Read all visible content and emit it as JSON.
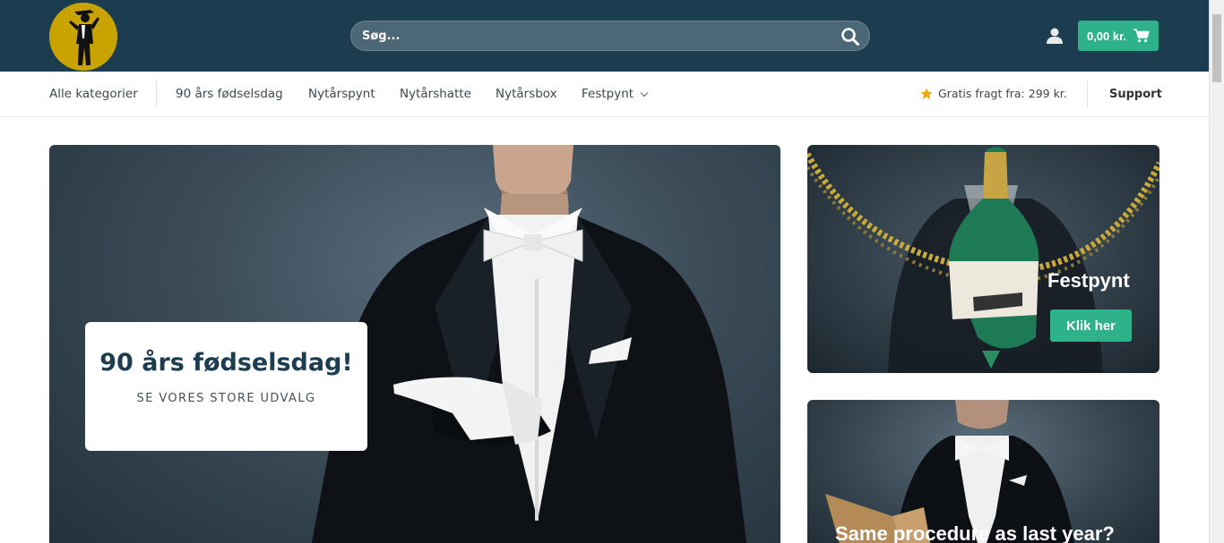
{
  "header": {
    "logo_alt": "Festlogo",
    "search": {
      "placeholder": "Søg..."
    },
    "cart": {
      "total": "0,00 kr."
    }
  },
  "nav": {
    "all_categories": "Alle kategorier",
    "items": [
      {
        "label": "90 års fødselsdag"
      },
      {
        "label": "Nytårspynt"
      },
      {
        "label": "Nytårshatte"
      },
      {
        "label": "Nytårsbox"
      },
      {
        "label": "Festpynt"
      }
    ],
    "shipping_text": "Gratis fragt fra: 299 kr.",
    "support_label": "Support"
  },
  "hero": {
    "title": "90 års fødselsdag!",
    "subtitle": "SE VORES STORE UDVALG"
  },
  "banners": [
    {
      "title": "Festpynt",
      "button_label": "Klik her"
    },
    {
      "title": "Same procedure as last year?"
    }
  ],
  "colors": {
    "header_bg": "#1c3d4f",
    "accent": "#2db28a",
    "logo_bg": "#c9a400",
    "star": "#f0a500"
  },
  "icons": {
    "search": "search-icon",
    "account": "user-icon",
    "cart": "cart-icon",
    "chevron": "chevron-down-icon",
    "star": "star-icon"
  }
}
